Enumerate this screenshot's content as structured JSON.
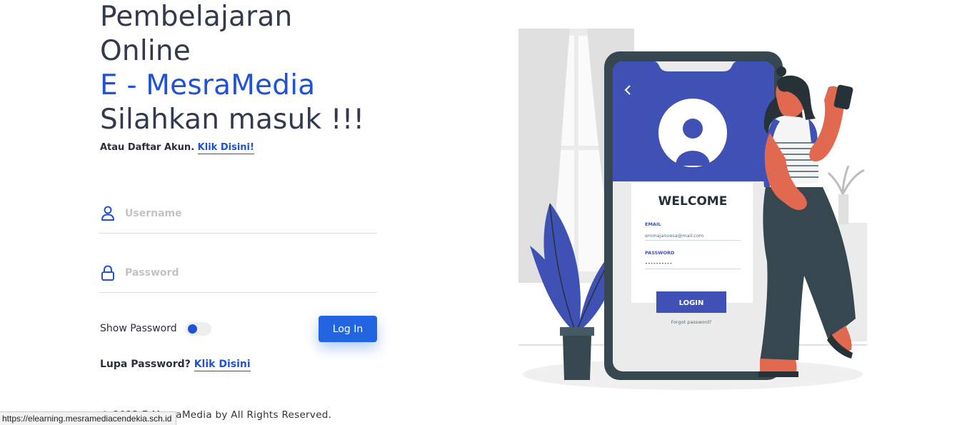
{
  "hero": {
    "line1": "Pembelajaran",
    "line2": "Online",
    "brand": "E - MesraMedia",
    "line4": "Silahkan masuk !!!"
  },
  "signup": {
    "text": "Atau Daftar Akun.",
    "link": "Klik Disini!"
  },
  "form": {
    "username_placeholder": "Username",
    "password_placeholder": "Password",
    "show_password_label": "Show Password",
    "show_password_on": false,
    "login_label": "Log In"
  },
  "forgot": {
    "text": "Lupa Password?",
    "link": "Klik Disini"
  },
  "footer": {
    "text": "© 2023 E-MesraMedia by All Rights Reserved."
  },
  "statusbar": {
    "url": "https://elearning.mesramediacendekia.sch.id"
  },
  "illustration": {
    "welcome": "WELCOME",
    "email_label": "EMAIL",
    "email_value": "emmajanvesa@mail.com",
    "password_label": "PASSWORD",
    "password_value": "••••••••••",
    "login_label": "LOGIN",
    "forgot_label": "Forgot password?"
  },
  "colors": {
    "accent": "#2052d8",
    "button": "#2166e0",
    "illustration_blue": "#3f51b5",
    "dark": "#37474f"
  }
}
